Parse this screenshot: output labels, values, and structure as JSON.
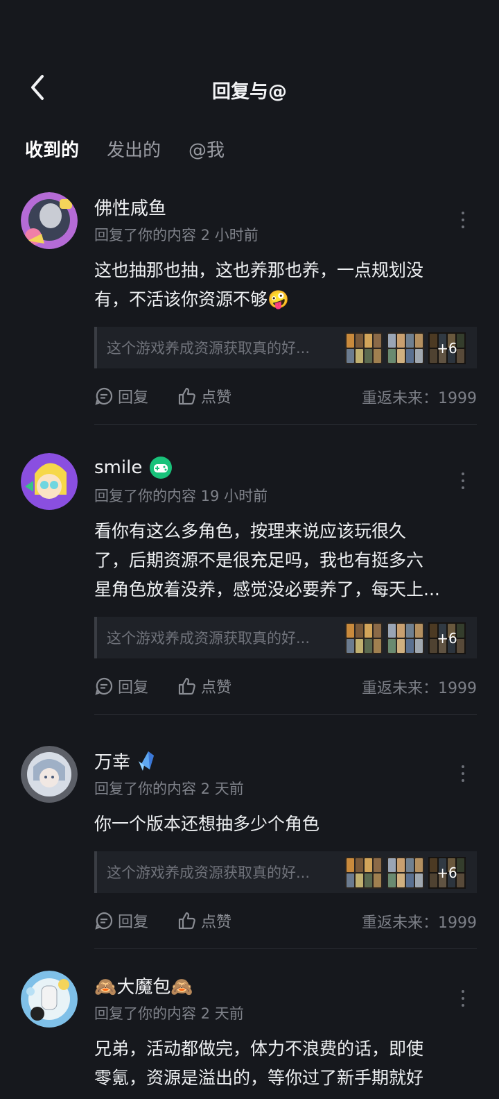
{
  "header": {
    "title": "回复与@"
  },
  "tabs": [
    {
      "label": "收到的",
      "active": true
    },
    {
      "label": "发出的",
      "active": false
    },
    {
      "label": "@我",
      "active": false
    }
  ],
  "items": [
    {
      "name": "佛性咸鱼",
      "meta": "回复了你的内容 2 小时前",
      "content": "这也抽那也抽，这也养那也养，一点规划没\n有，不活该你资源不够",
      "emoji": "🤪",
      "quote": "这个游戏养成资源获取真的好...",
      "more_count": "+6",
      "reply_label": "回复",
      "like_label": "点赞",
      "game": "重返未来：1999"
    },
    {
      "name": "smile",
      "meta": "回复了你的内容 19 小时前",
      "content": "看你有这么多角色，按理来说应该玩很久\n了，后期资源不是很充足吗，我也有挺多六\n星角色放着没养，感觉没必要养了，每天上...",
      "quote": "这个游戏养成资源获取真的好...",
      "more_count": "+6",
      "reply_label": "回复",
      "like_label": "点赞",
      "game": "重返未来：1999"
    },
    {
      "name": "万幸",
      "meta": "回复了你的内容 2 天前",
      "content": "你一个版本还想抽多少个角色",
      "quote": "这个游戏养成资源获取真的好...",
      "more_count": "+6",
      "reply_label": "回复",
      "like_label": "点赞",
      "game": "重返未来：1999"
    },
    {
      "name": "🙈大魔包🙈",
      "meta": "回复了你的内容 2 天前",
      "content": "兄弟，活动都做完，体力不浪费的话，即使\n零氪，资源是溢出的，等你过了新手期就好"
    }
  ]
}
